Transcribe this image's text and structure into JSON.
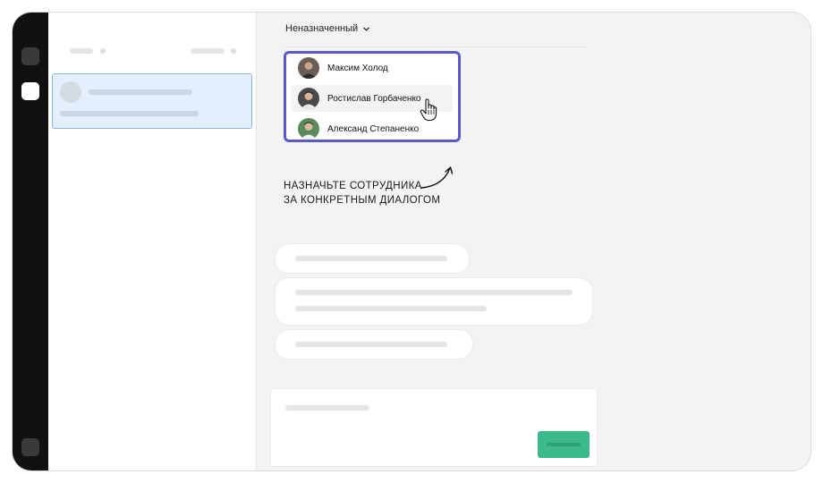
{
  "header": {
    "assign_select_label": "Неназначенный"
  },
  "employees": [
    {
      "name": "Максим Холод"
    },
    {
      "name": "Ростислав Горбаченко"
    },
    {
      "name": "Александ Степаненко"
    }
  ],
  "hint": {
    "line1": "НАЗНАЧЬТЕ СОТРУДНИКА",
    "line2": "ЗА КОНКРЕТНЫМ ДИАЛОГОМ"
  },
  "colors": {
    "rail": "#111111",
    "dropdown_border": "#5a5ac8",
    "selected_dialog": "#e4effd",
    "send_button": "#3cba8c"
  },
  "icons": [
    "chevron-down-icon",
    "hand-pointer-cursor",
    "curved-arrow-icon"
  ]
}
